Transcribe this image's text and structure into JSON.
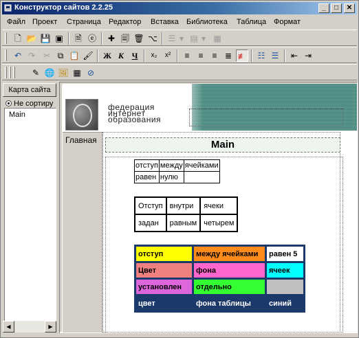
{
  "window": {
    "title": "Конструктор сайтов 2.2.25",
    "controls": {
      "minimize": "_",
      "maximize": "□",
      "close": "✕"
    }
  },
  "menu": [
    "Файл",
    "Проект",
    "Страница",
    "Редактор",
    "Вставка",
    "Библиотека",
    "Таблица",
    "Формат"
  ],
  "toolbar2": {
    "bold": "Ж",
    "italic": "К",
    "underline": "Ч",
    "subscript": "x₂",
    "superscript": "x²"
  },
  "left_panel": {
    "tab": "Карта сайта",
    "radio_label": "Не сортиру",
    "tree_items": [
      "Main"
    ]
  },
  "page": {
    "logo_text": [
      "федерация",
      "интернет",
      "образования"
    ],
    "nav_label": "Главная",
    "title": "Main",
    "table1": [
      [
        "отступ",
        "между",
        "ячейками"
      ],
      [
        "равен",
        "нулю",
        ""
      ]
    ],
    "table2": [
      [
        "Отступ",
        "внутри",
        "ячеки"
      ],
      [
        "задан",
        "равным",
        "четырем"
      ]
    ],
    "table3": [
      [
        {
          "text": "отступ",
          "bg": "#ffff00"
        },
        {
          "text": "между ячейками",
          "bg": "#ff8c1a"
        },
        {
          "text": "равен 5",
          "bg": "#ffffff"
        }
      ],
      [
        {
          "text": "Цвет",
          "bg": "#f08080"
        },
        {
          "text": "фона",
          "bg": "#ff66cc"
        },
        {
          "text": "ячеек",
          "bg": "#00ffff"
        }
      ],
      [
        {
          "text": "установлен",
          "bg": "#dd66dd"
        },
        {
          "text": "отдельно",
          "bg": "#33ff33"
        },
        {
          "text": "",
          "bg": "#c0c0c0"
        }
      ],
      [
        {
          "text": "цвет",
          "bg": "#1b3a6b"
        },
        {
          "text": "фона таблицы",
          "bg": "#1b3a6b"
        },
        {
          "text": "синий",
          "bg": "#1b3a6b"
        }
      ]
    ]
  },
  "colors": {
    "titlebar": "#0a246a",
    "table_background": "#1b3a6b",
    "header_stripe": "#3d7c74"
  }
}
